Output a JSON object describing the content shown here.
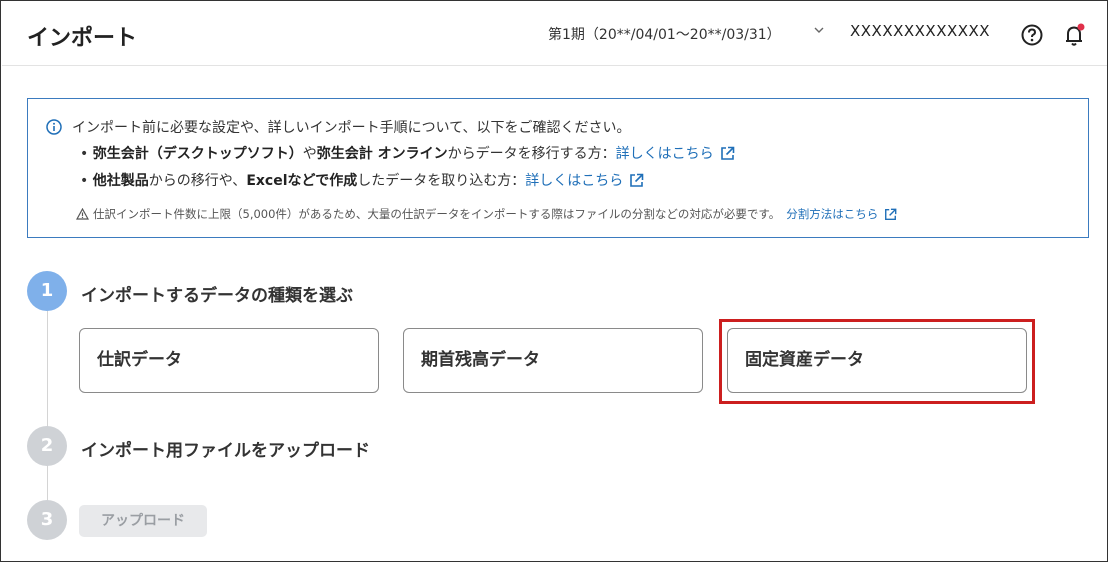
{
  "header": {
    "title": "インポート",
    "period": "第1期（20**/04/01〜20**/03/31）",
    "company": "XXXXXXXXXXXXX"
  },
  "info": {
    "intro": "インポート前に必要な設定や、詳しいインポート手順について、以下をご確認ください。",
    "row1": {
      "bold1": "弥生会計（デスクトップソフト）",
      "text1": "や",
      "bold2": "弥生会計 オンライン",
      "text2": "からデータを移行する方：",
      "link": "詳しくはこちら"
    },
    "row2": {
      "bold1": "他社製品",
      "text1": "からの移行や、",
      "bold2": "Excelなどで作成",
      "text2": "したデータを取り込む方：",
      "link": "詳しくはこちら"
    },
    "note": "仕訳インポート件数に上限（5,000件）があるため、大量の仕訳データをインポートする際はファイルの分割などの対応が必要です。",
    "note_link": "分割方法はこちら"
  },
  "steps": [
    {
      "number": "1",
      "title": "インポートするデータの種類を選ぶ"
    },
    {
      "number": "2",
      "title": "インポート用ファイルをアップロード"
    },
    {
      "number": "3"
    }
  ],
  "data_types": [
    "仕訳データ",
    "期首残高データ",
    "固定資産データ"
  ],
  "upload_label": "アップロード",
  "colors": {
    "accent": "#1f6fb8",
    "step_active": "#7fb0ea",
    "step_inactive": "#cfd2d6",
    "highlight": "#cc1f1f",
    "notification_dot": "#e0304a"
  }
}
